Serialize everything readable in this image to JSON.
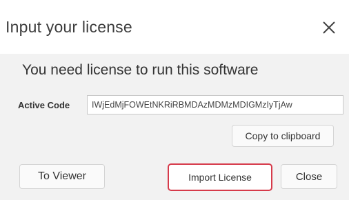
{
  "dialog": {
    "title": "Input your license",
    "close_icon": "close-x-icon",
    "message": "You need license to run this software",
    "active_code": {
      "label": "Active Code",
      "value": "IWjEdMjFOWEtNKRiRBMDAzMDMzMDIGMzIyTjAw"
    },
    "buttons": {
      "copy_label": "Copy to clipboard",
      "viewer_label": "To Viewer",
      "import_label": "Import License",
      "close_label": "Close"
    },
    "highlight_color": "#d63a4a"
  }
}
